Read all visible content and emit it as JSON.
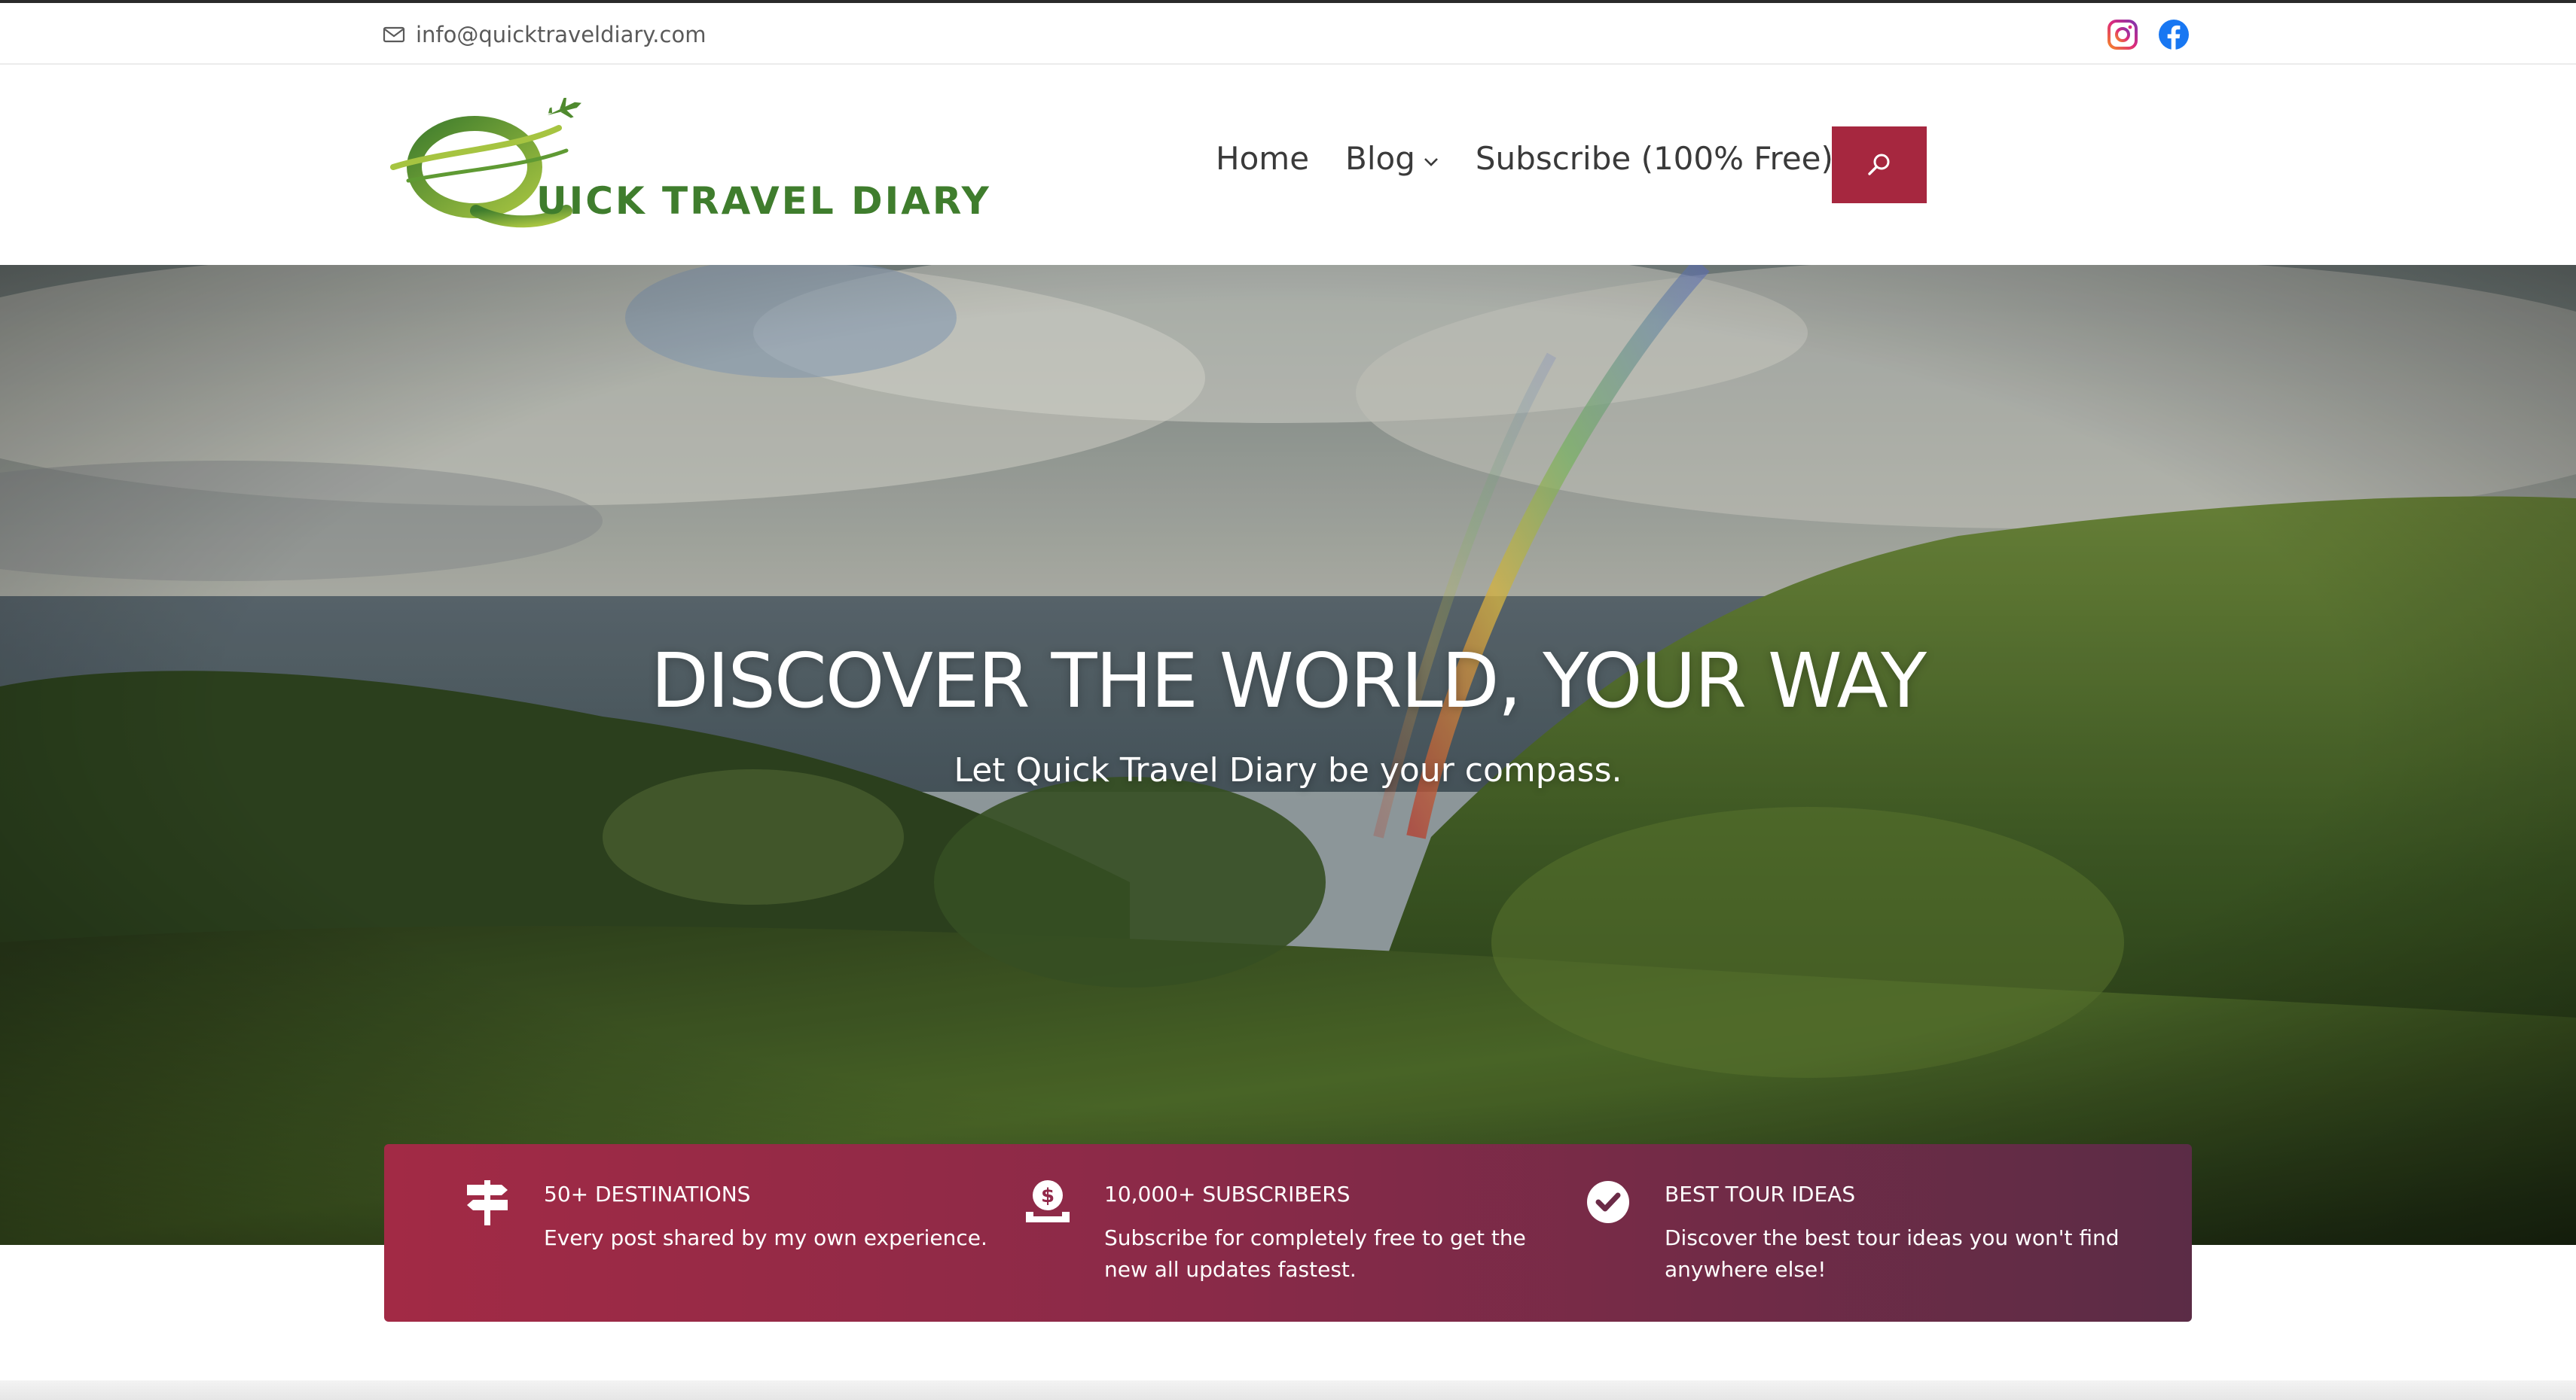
{
  "topbar": {
    "email": "info@quicktraveldiary.com",
    "email_icon": "mail-icon",
    "social": [
      {
        "name": "instagram",
        "icon": "instagram-icon",
        "color": "#e1306c"
      },
      {
        "name": "facebook",
        "icon": "facebook-icon",
        "color": "#1877f2"
      }
    ]
  },
  "header": {
    "logo_text": "UICK TRAVEL DIARY",
    "logo_letter": "Q",
    "nav": [
      {
        "label": "Home"
      },
      {
        "label": "Blog",
        "has_dropdown": true
      },
      {
        "label": "Subscribe (100% Free)"
      }
    ],
    "search_icon": "search-icon",
    "accent_color": "#a6273f",
    "logo_color": "#3f7d2d"
  },
  "hero": {
    "title": "DISCOVER THE WORLD, YOUR WAY",
    "subtitle": "Let Quick Travel Diary be your compass."
  },
  "features": [
    {
      "icon": "signpost-icon",
      "title": "50+ DESTINATIONS",
      "description": "Every post shared by my own experience."
    },
    {
      "icon": "money-hand-icon",
      "title": "10,000+ SUBSCRIBERS",
      "description": "Subscribe for completely free to get the new all updates fastest."
    },
    {
      "icon": "checkmark-circle-icon",
      "title": "BEST TOUR IDEAS",
      "description": "Discover the best tour ideas you won't find anywhere else!"
    }
  ]
}
